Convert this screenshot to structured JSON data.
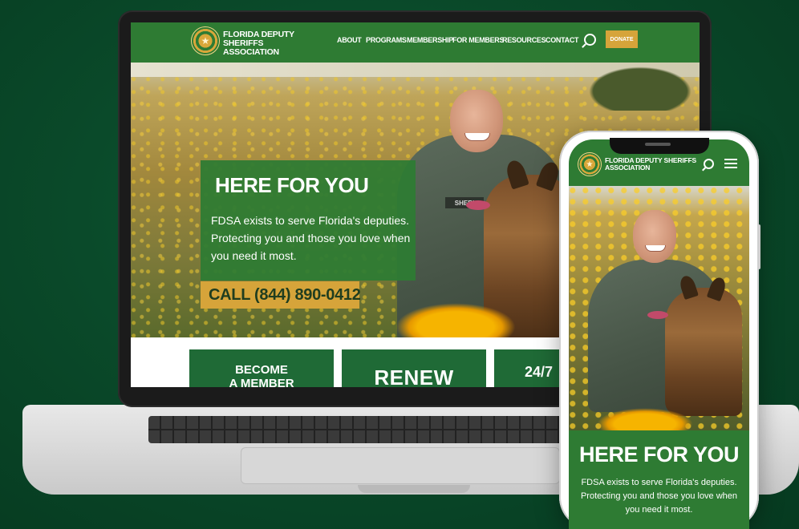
{
  "colors": {
    "brand_green": "#2e7b33",
    "tile_green": "#1f6a36",
    "accent_gold": "#d6a43a",
    "background": "#0a4a2a"
  },
  "desktop": {
    "header": {
      "logo_line1": "FLORIDA DEPUTY SHERIFFS",
      "logo_line2": "ASSOCIATION",
      "nav": [
        "ABOUT",
        "PROGRAMS",
        "MEMBERSHIP",
        "FOR MEMBERS",
        "RESOURCES",
        "CONTACT"
      ],
      "search_icon": "search-icon",
      "donate_label": "DONATE"
    },
    "hero": {
      "title": "HERE FOR YOU",
      "text": "FDSA exists to serve Florida's deputies. Protecting you and those you love when you need it most.",
      "call": "CALL (844) 890-0412",
      "patch_text": "SHERI"
    },
    "tiles": {
      "tile1_line1": "BECOME",
      "tile1_line2": "A MEMBER",
      "tile2": "RENEW",
      "tile3": "24/7"
    }
  },
  "mobile": {
    "header": {
      "logo_line1": "FLORIDA DEPUTY SHERIFFS",
      "logo_line2": "ASSOCIATION",
      "search_icon": "search-icon",
      "menu_icon": "hamburger-menu-icon"
    },
    "hero": {
      "title": "HERE FOR YOU",
      "text": "FDSA exists to serve Florida's deputies. Protecting you and those you love when you need it most."
    }
  }
}
